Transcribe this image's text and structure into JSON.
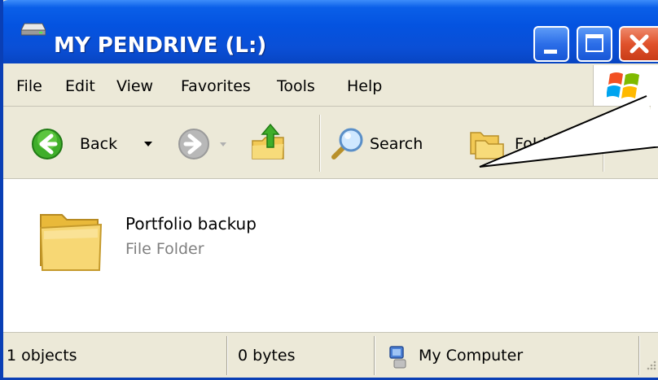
{
  "window": {
    "title": "MY PENDRIVE (L:)",
    "icon": "drive-icon"
  },
  "menu": {
    "items": [
      "File",
      "Edit",
      "View",
      "Favorites",
      "Tools",
      "Help"
    ]
  },
  "toolbar": {
    "back_label": "Back",
    "search_label": "Search",
    "folders_label": "Folders",
    "overflow_glyph": "»"
  },
  "content": {
    "items": [
      {
        "name": "Portfolio backup",
        "type": "File Folder",
        "icon": "folder-icon"
      }
    ]
  },
  "statusbar": {
    "objects": "1 objects",
    "size": "0 bytes",
    "location": "My Computer"
  },
  "colors": {
    "titlebar": "#0453e0",
    "chrome": "#ece9d8",
    "close_button": "#e0522c"
  }
}
